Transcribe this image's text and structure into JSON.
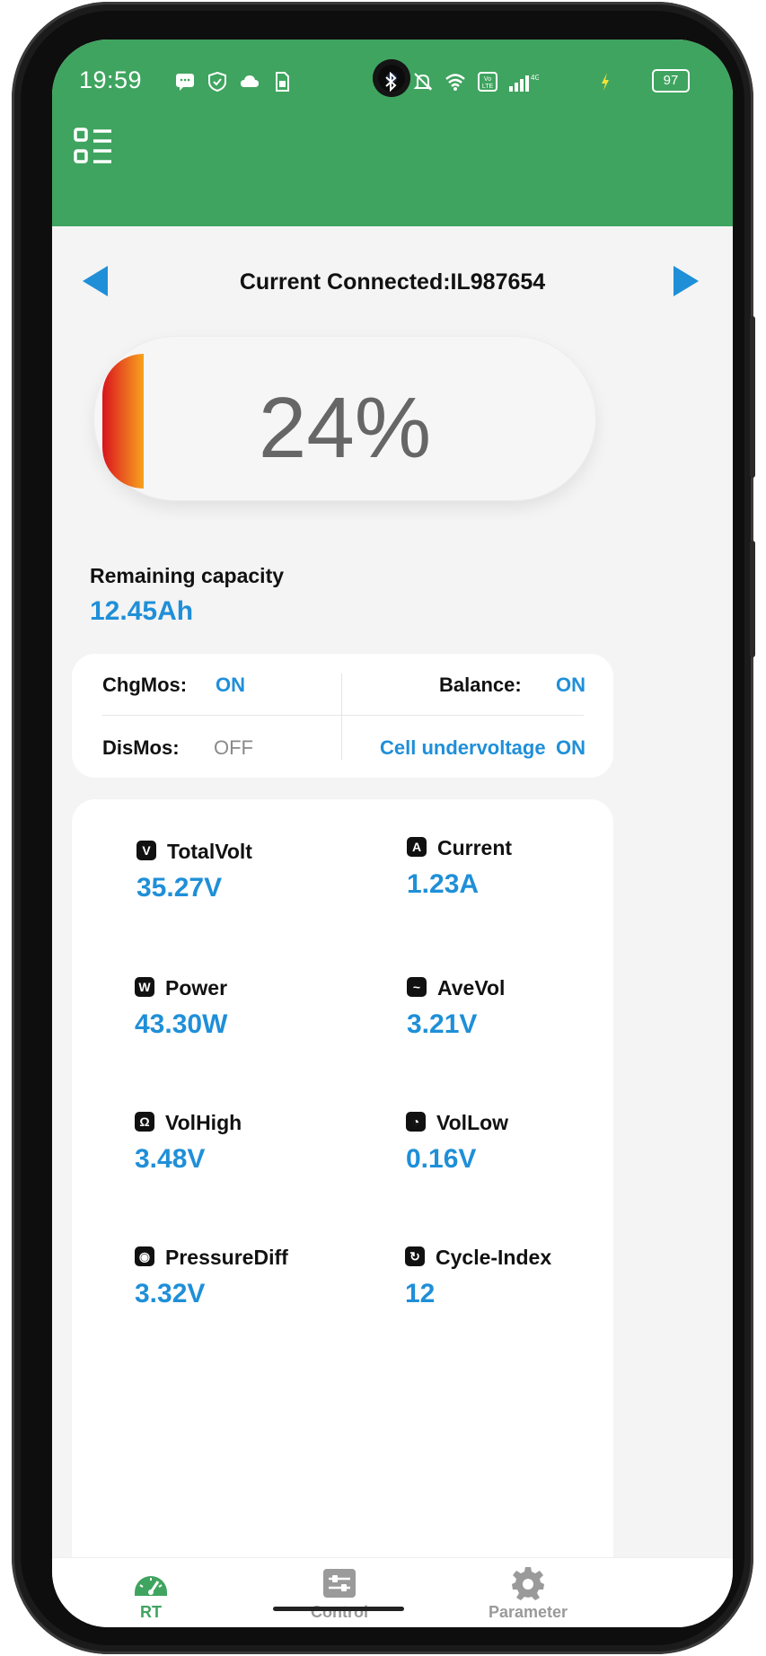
{
  "status_bar": {
    "time": "19:59",
    "battery_level": "97",
    "network": "4G",
    "icons": [
      "message-icon",
      "shield-icon",
      "cloud-icon",
      "sim-icon",
      "bluetooth-icon",
      "mute-icon",
      "wifi-icon",
      "volte-icon",
      "signal-icon",
      "battery-icon",
      "charging-icon"
    ]
  },
  "header": {
    "menu_icon": "menu-grid-icon",
    "color": "#3fa45f"
  },
  "connection": {
    "label": "Current Connected:IL987654",
    "prev_icon": "arrow-left-icon",
    "next_icon": "arrow-right-icon"
  },
  "soc": {
    "percent_text": "24%",
    "level": 0.24
  },
  "remaining": {
    "label": "Remaining capacity",
    "value": "12.45Ah"
  },
  "mos": {
    "chg_label": "ChgMos:",
    "chg_value": "ON",
    "dis_label": "DisMos:",
    "dis_value": "OFF",
    "balance_label": "Balance:",
    "balance_value": "ON",
    "undervolt_label": "Cell undervoltage",
    "undervolt_value": "ON"
  },
  "metrics": [
    {
      "label": "TotalVolt",
      "value": "35.27V",
      "icon": "voltage-icon"
    },
    {
      "label": "Current",
      "value": "1.23A",
      "icon": "current-icon"
    },
    {
      "label": "Power",
      "value": "43.30W",
      "icon": "power-icon"
    },
    {
      "label": "AveVol",
      "value": "3.21V",
      "icon": "average-icon"
    },
    {
      "label": "VolHigh",
      "value": "3.48V",
      "icon": "volhigh-icon"
    },
    {
      "label": "VolLow",
      "value": "0.16V",
      "icon": "vollow-icon"
    },
    {
      "label": "PressureDiff",
      "value": "3.32V",
      "icon": "pressure-icon"
    },
    {
      "label": "Cycle-Index",
      "value": "12",
      "icon": "cycle-icon"
    }
  ],
  "nav": {
    "items": [
      {
        "label": "RT",
        "icon": "gauge-icon",
        "active": true
      },
      {
        "label": "Control",
        "icon": "sliders-icon",
        "active": false
      },
      {
        "label": "Parameter",
        "icon": "gear-icon",
        "active": false
      }
    ]
  },
  "colors": {
    "accent": "#1f8fd8",
    "green": "#3fa45f",
    "off": "#8a8a8a",
    "inactive_nav": "#9a9a9a"
  }
}
